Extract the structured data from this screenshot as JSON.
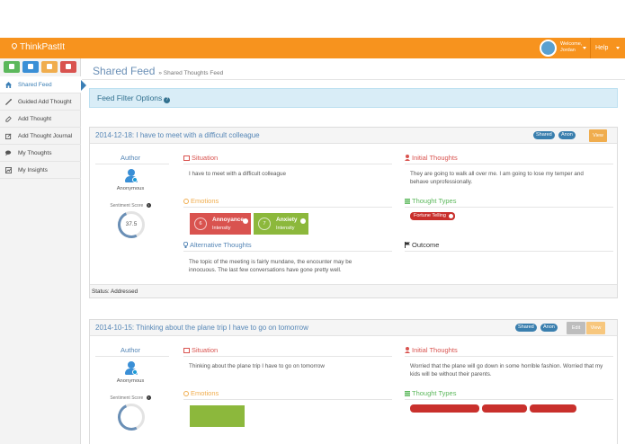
{
  "app": {
    "brand": "ThinkPastIt",
    "welcome_label": "Welcome,",
    "user_name": "Jordan",
    "help_label": "Help",
    "colors": {
      "topbar": "#f7931e",
      "accent": "#3b7fb6"
    }
  },
  "shortcuts": [
    {
      "icon": "home-icon",
      "color": "#5cb85c"
    },
    {
      "icon": "user-icon",
      "color": "#3a8fd6"
    },
    {
      "icon": "lightbulb-icon",
      "color": "#f0ad4e"
    },
    {
      "icon": "chart-icon",
      "color": "#d9534f"
    }
  ],
  "sidebar": {
    "items": [
      {
        "label": "Shared Feed",
        "icon": "home-icon",
        "active": true
      },
      {
        "label": "Guided Add Thought",
        "icon": "wand-icon",
        "active": false
      },
      {
        "label": "Add Thought",
        "icon": "pencil-icon",
        "active": false
      },
      {
        "label": "Add Thought Journal",
        "icon": "edit-icon",
        "active": false
      },
      {
        "label": "My Thoughts",
        "icon": "comments-icon",
        "active": false
      },
      {
        "label": "My Insights",
        "icon": "chart-icon",
        "active": false
      }
    ]
  },
  "page": {
    "title": "Shared Feed",
    "breadcrumb": "» Shared Thoughts Feed",
    "filter_label": "Feed Filter Options"
  },
  "labels": {
    "author": "Author",
    "situation": "Situation",
    "initial_thoughts": "Initial Thoughts",
    "emotions": "Emotions",
    "thought_types": "Thought Types",
    "alternative_thoughts": "Alternative Thoughts",
    "outcome": "Outcome",
    "sentiment_score": "Sentiment Score",
    "shared_badge": "Shared",
    "anon_badge": "Anon",
    "view_button": "View",
    "edit_button": "Edit"
  },
  "cards": [
    {
      "title": "2014-12-18: I have to meet with a difficult colleague",
      "author": "Anonymous",
      "sentiment": "37.5",
      "situation": "I have to meet with a difficult colleague",
      "initial_thoughts": "They are going to walk all over me. I am going to lose my temper and behave unprofessionally.",
      "emotions": [
        {
          "name": "Annoyance",
          "value": "6",
          "sub": "Intensity",
          "color": "#d9534f"
        },
        {
          "name": "Anxiety",
          "value": "7",
          "sub": "Intensity",
          "color": "#8cb83c"
        }
      ],
      "thought_types": [
        "Fortune Telling"
      ],
      "alternative_thoughts": "The topic of the meeting is fairly mundane, the encounter may be innocuous. The last few conversations have gone pretty well.",
      "status": "Status: Addressed"
    },
    {
      "title": "2014-10-15: Thinking about the plane trip I have to go on tomorrow",
      "author": "Anonymous",
      "situation": "Thinking about the plane trip I have to go on tomorrow",
      "initial_thoughts": "Worried that the plane will go down in some horrible fashion. Worried that my kids will be without their parents."
    }
  ]
}
